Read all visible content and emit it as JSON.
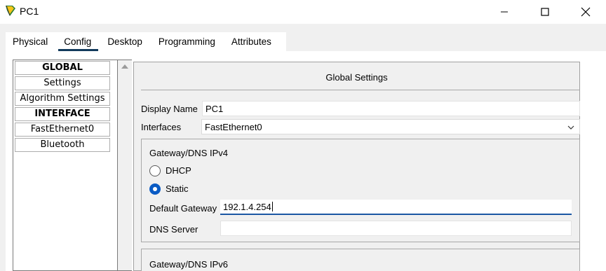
{
  "window": {
    "title": "PC1",
    "icon": "pc-app-icon",
    "controls": [
      "minimize-icon",
      "maximize-icon",
      "close-icon"
    ]
  },
  "tabs": [
    {
      "label": "Physical",
      "active": false
    },
    {
      "label": "Config",
      "active": true
    },
    {
      "label": "Desktop",
      "active": false
    },
    {
      "label": "Programming",
      "active": false
    },
    {
      "label": "Attributes",
      "active": false
    }
  ],
  "sidebar": {
    "items": [
      {
        "label": "GLOBAL",
        "header": true
      },
      {
        "label": "Settings",
        "header": false
      },
      {
        "label": "Algorithm Settings",
        "header": false
      },
      {
        "label": "INTERFACE",
        "header": true
      },
      {
        "label": "FastEthernet0",
        "header": false
      },
      {
        "label": "Bluetooth",
        "header": false
      }
    ]
  },
  "panel": {
    "title": "Global Settings",
    "display_name_label": "Display Name",
    "display_name_value": "PC1",
    "interfaces_label": "Interfaces",
    "interfaces_value": "FastEthernet0",
    "ipv4_group": {
      "title": "Gateway/DNS IPv4",
      "dhcp_label": "DHCP",
      "static_label": "Static",
      "selected": "Static",
      "default_gateway_label": "Default Gateway",
      "default_gateway_value": "192.1.4.254",
      "dns_server_label": "DNS Server",
      "dns_server_value": ""
    },
    "ipv6_group": {
      "title": "Gateway/DNS IPv6"
    }
  },
  "colors": {
    "active_tab_underline": "#123a5c",
    "radio_selected": "#0a5bc4",
    "focused_field_underline": "#1b57a3"
  }
}
